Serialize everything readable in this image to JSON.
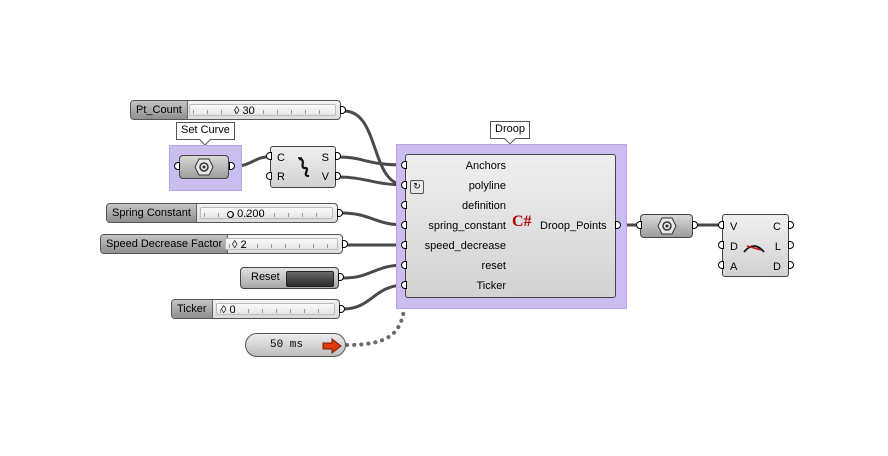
{
  "canvas": {
    "background": "#ffffff",
    "group_color": "#ccbdf0"
  },
  "sliders": {
    "pt_count": {
      "label": "Pt_Count",
      "value": "30"
    },
    "spring_constant": {
      "label": "Spring Constant",
      "value": "0.200"
    },
    "speed_decrease": {
      "label": "Speed Decrease Factor",
      "value": "2"
    },
    "ticker": {
      "label": "Ticker",
      "value": "0"
    }
  },
  "groups": {
    "set_curve": {
      "label": "Set Curve"
    },
    "droop": {
      "label": "Droop"
    }
  },
  "curve_component": {
    "inputs": [
      "C",
      "R"
    ],
    "outputs": [
      "S",
      "V"
    ]
  },
  "droop_component": {
    "inputs": [
      "Anchors",
      "polyline",
      "definition",
      "spring_constant",
      "speed_decrease",
      "reset",
      "Ticker"
    ],
    "output": "Droop_Points",
    "icon": "C#"
  },
  "button": {
    "label": "Reset"
  },
  "timer": {
    "label": "50 ms"
  },
  "end_component": {
    "inputs": [
      "V",
      "D",
      "A"
    ],
    "outputs": [
      "C",
      "L",
      "D"
    ]
  }
}
